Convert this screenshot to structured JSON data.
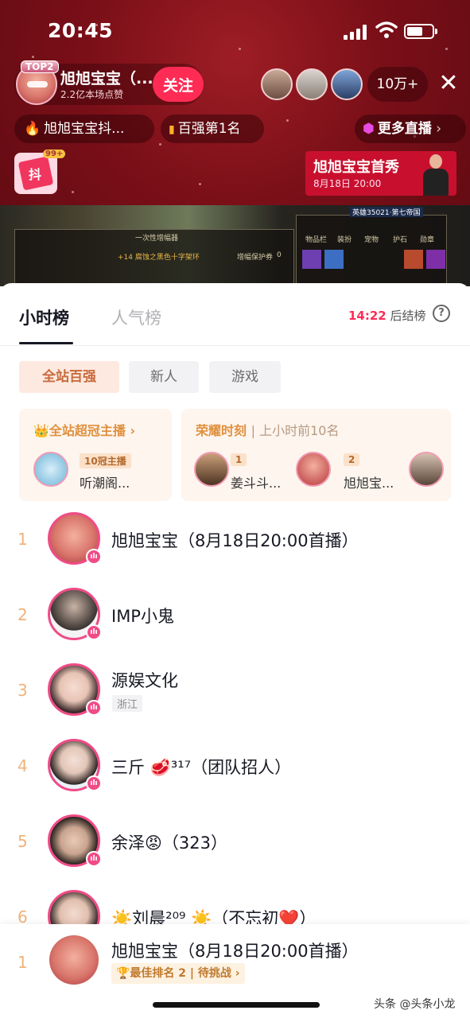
{
  "status_bar": {
    "time": "20:45"
  },
  "live_room": {
    "host_name": "旭旭宝宝（...",
    "host_badge": "TOP2",
    "likes": "2.2亿本场点赞",
    "follow_label": "关注",
    "viewer_count": "10万+",
    "close_icon": "close-icon",
    "chips": [
      {
        "icon": "flame-icon",
        "label": "旭旭宝宝抖..."
      },
      {
        "icon": "bars-icon",
        "label": "百强第1名"
      },
      {
        "icon": "live-icon",
        "label": "更多直播"
      }
    ],
    "gift_count": "99+",
    "gift_logo": "抖",
    "promo": {
      "title": "旭旭宝宝首秀",
      "time": "8月18日 20:00"
    },
    "game_texts": [
      "一次性增幅器",
      "+14 腐蚀之黑色十字架环",
      "增幅保护券",
      "0",
      "英雄35021·第七帝国",
      "物品栏",
      "装扮",
      "宠物",
      "护石",
      "勋章"
    ]
  },
  "ranking": {
    "tabs": [
      {
        "label": "小时榜",
        "active": true
      },
      {
        "label": "人气榜",
        "active": false
      }
    ],
    "countdown": {
      "time": "14:22",
      "label": "后结榜"
    },
    "filters": [
      {
        "label": "全站百强",
        "active": true
      },
      {
        "label": "新人",
        "active": false
      },
      {
        "label": "游戏",
        "active": false
      }
    ],
    "champion_card": {
      "title": "全站超冠主播",
      "tag": "10冠主播",
      "name": "听潮阁..."
    },
    "glory_card": {
      "title": "荣耀时刻",
      "subtitle": "上小时前10名",
      "entries": [
        {
          "rank": "1",
          "name": "姜斗斗..."
        },
        {
          "rank": "2",
          "name": "旭旭宝..."
        }
      ]
    },
    "rows": [
      {
        "rank": "1",
        "name": "旭旭宝宝（8月18日20:00首播）",
        "region": ""
      },
      {
        "rank": "2",
        "name": "IMP小鬼",
        "region": ""
      },
      {
        "rank": "3",
        "name": "源娱文化",
        "region": "浙江"
      },
      {
        "rank": "4",
        "name": "三斤 🥩³¹⁷（团队招人）",
        "region": ""
      },
      {
        "rank": "5",
        "name": "余泽😡（323）",
        "region": ""
      },
      {
        "rank": "6",
        "name": "☀️刘晨²⁰⁹ ☀️（不忘初❤️）",
        "region": ""
      }
    ],
    "my_rank": {
      "rank": "1",
      "name": "旭旭宝宝（8月18日20:00首播）",
      "best": "🏆最佳排名 2 | 待挑战 ›"
    }
  },
  "watermark": "头条 @头条小龙",
  "colors": {
    "accent": "#fe2c55",
    "live_ring": "#f04b87",
    "rank_number": "#f0b27a",
    "room_bg": "#7a0f18"
  }
}
